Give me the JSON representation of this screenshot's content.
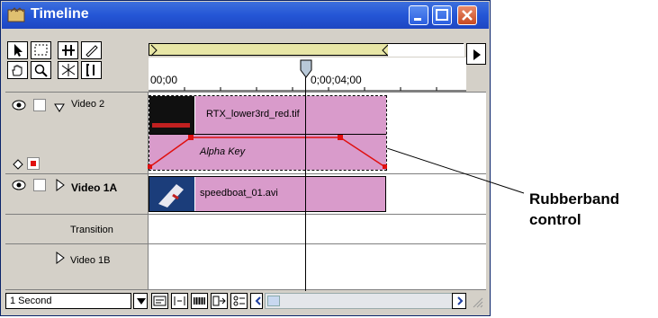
{
  "window": {
    "title": "Timeline"
  },
  "ruler": {
    "timecode_start": "00;00",
    "timecode_mid": "0;00;04;00"
  },
  "tracks": [
    {
      "name": "Video 2"
    },
    {
      "name": "Video 1A"
    },
    {
      "name": "Transition"
    },
    {
      "name": "Video 1B"
    }
  ],
  "clips": {
    "video2": "RTX_lower3rd_red.tif",
    "alpha": "Alpha Key",
    "video1a": "speedboat_01.avi"
  },
  "bottom": {
    "zoom": "1 Second"
  },
  "annotation": {
    "line1": "Rubberband",
    "line2": "control"
  },
  "colors": {
    "title_bar": "#2456d6",
    "clip": "#d99bcb",
    "rubberband": "#e01010",
    "navigator": "#e8e6a6"
  },
  "icons": [
    "eye-icon",
    "triangle-down-icon",
    "triangle-right-icon",
    "selection-arrow-icon",
    "hand-icon",
    "zoom-icon",
    "razor-icon"
  ]
}
